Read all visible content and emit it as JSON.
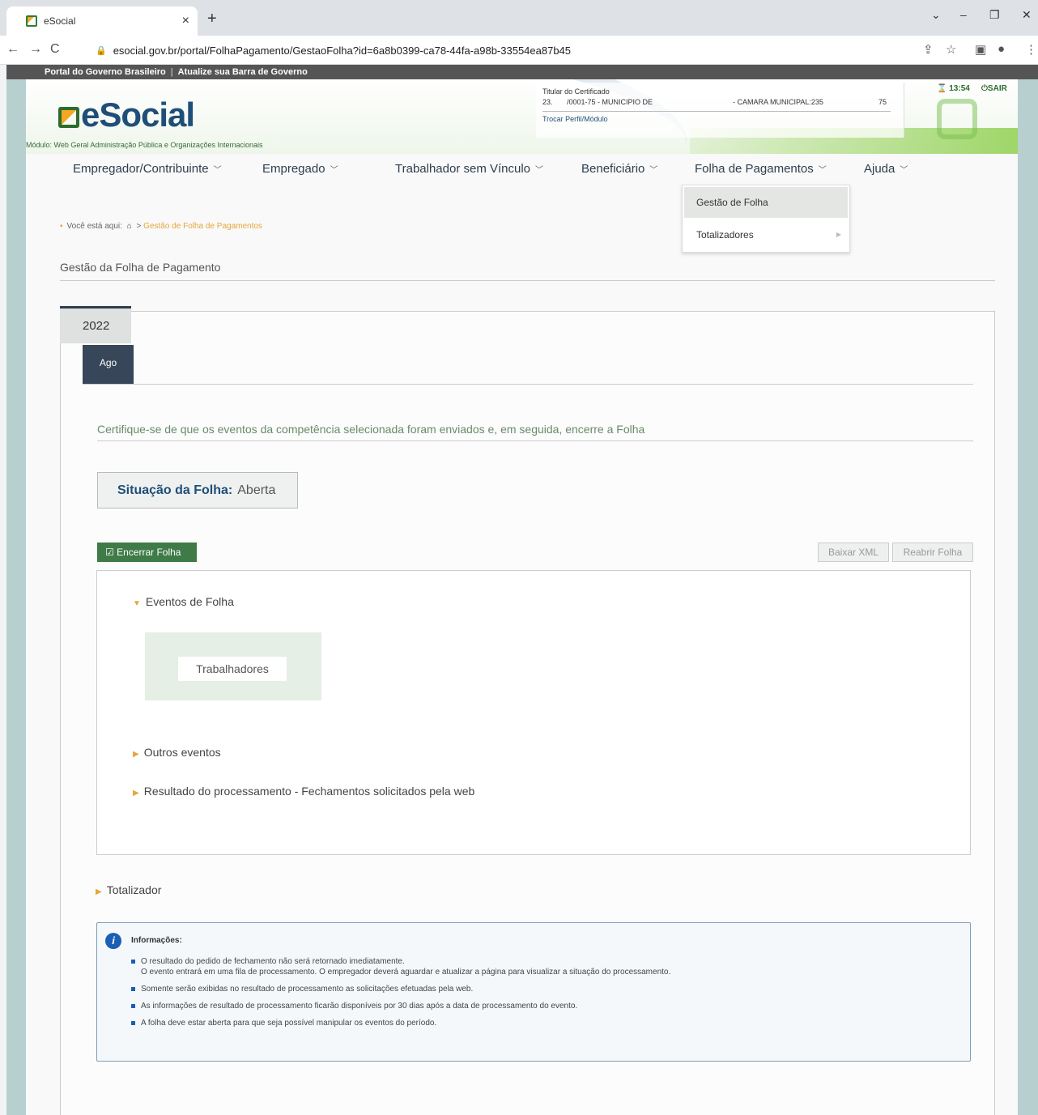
{
  "browser": {
    "tab_title": "eSocial",
    "url": "esocial.gov.br/portal/FolhaPagamento/GestaoFolha?id=6a8b0399-ca78-44fa-a98b-33554ea87b45"
  },
  "govbar": {
    "portal": "Portal do Governo Brasileiro",
    "atualize": "Atualize sua Barra de Governo"
  },
  "header": {
    "logo": "eSocial",
    "modulo": "Módulo: Web Geral Administração Pública e Organizações Internacionais",
    "cert_title": "Titular do Certificado",
    "cert_num": "23.",
    "cert_cnpj": "/0001-75 - MUNICIPIO DE",
    "cert_org": "- CAMARA MUNICIPAL:235",
    "cert_suffix": "75",
    "trocar": "Trocar Perfil/Módulo",
    "time": "13:54",
    "sair": "SAIR"
  },
  "menu": {
    "items": [
      {
        "label": "Empregador/Contribuinte"
      },
      {
        "label": "Empregado"
      },
      {
        "label": "Trabalhador sem Vínculo"
      },
      {
        "label": "Beneficiário"
      },
      {
        "label": "Folha de Pagamentos"
      },
      {
        "label": "Ajuda"
      }
    ],
    "dropdown": [
      "Gestão de Folha",
      "Totalizadores"
    ]
  },
  "breadcrumb": {
    "prefix": "Você está aqui:",
    "sep": ">",
    "current": "Gestão de Folha de Pagamentos"
  },
  "page_title": "Gestão da Folha de Pagamento",
  "year": "2022",
  "month": "Ago",
  "instruction": "Certifique-se de que os eventos da competência selecionada foram enviados e, em seguida, encerre a Folha",
  "situacao": {
    "label": "Situação da Folha:",
    "value": "Aberta"
  },
  "buttons": {
    "encerrar": "Encerrar Folha",
    "baixar": "Baixar XML",
    "reabrir": "Reabrir Folha"
  },
  "sections": {
    "eventos": "Eventos de Folha",
    "trabalhadores": "Trabalhadores",
    "outros": "Outros eventos",
    "resultado": "Resultado do processamento - Fechamentos solicitados pela web",
    "totalizador": "Totalizador"
  },
  "info": {
    "title": "Informações:",
    "items": [
      "O resultado do pedido de fechamento não será retornado imediatamente.",
      "O evento entrará em uma fila de processamento. O empregador deverá aguardar e atualizar a página para visualizar a situação do processamento.",
      "Somente serão exibidas no resultado de processamento as solicitações efetuadas pela web.",
      "As informações de resultado de processamento ficarão disponíveis por 30 dias após a data de processamento do evento.",
      "A folha deve estar aberta para que seja possível manipular os eventos do período."
    ]
  }
}
